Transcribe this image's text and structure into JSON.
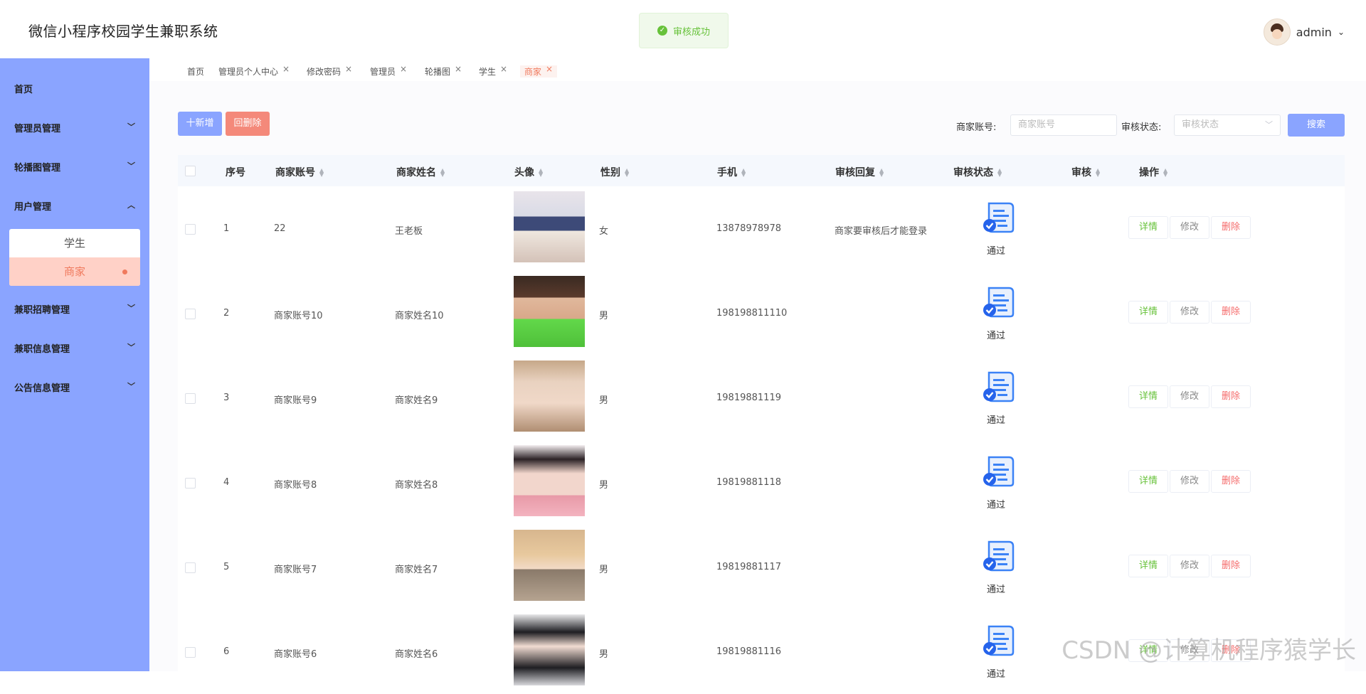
{
  "header": {
    "title": "微信小程序校园学生兼职系统",
    "toast": "审核成功",
    "username": "admin"
  },
  "sidebar": {
    "items": [
      {
        "label": "首页"
      },
      {
        "label": "管理员管理"
      },
      {
        "label": "轮播图管理"
      },
      {
        "label": "用户管理"
      },
      {
        "label": "兼职招聘管理"
      },
      {
        "label": "兼职信息管理"
      },
      {
        "label": "公告信息管理"
      }
    ],
    "submenu": [
      {
        "label": "学生"
      },
      {
        "label": "商家"
      }
    ]
  },
  "tabs": [
    {
      "label": "首页"
    },
    {
      "label": "管理员个人中心"
    },
    {
      "label": "修改密码"
    },
    {
      "label": "管理员"
    },
    {
      "label": "轮播图"
    },
    {
      "label": "学生"
    },
    {
      "label": "商家"
    }
  ],
  "toolbar": {
    "add_label": "十新增",
    "delete_label": "回删除",
    "account_label": "商家账号:",
    "account_placeholder": "商家账号",
    "status_label": "审核状态:",
    "status_placeholder": "审核状态",
    "search_label": "搜索"
  },
  "table": {
    "headers": [
      "序号",
      "商家账号",
      "商家姓名",
      "头像",
      "性别",
      "手机",
      "审核回复",
      "审核状态",
      "审核",
      "操作"
    ],
    "rows": [
      {
        "index": "1",
        "account": "22",
        "name": "王老板",
        "gender": "女",
        "phone": "13878978978",
        "reply": "商家要审核后才能登录",
        "status": "通过"
      },
      {
        "index": "2",
        "account": "商家账号10",
        "name": "商家姓名10",
        "gender": "男",
        "phone": "198198811110",
        "reply": "",
        "status": "通过"
      },
      {
        "index": "3",
        "account": "商家账号9",
        "name": "商家姓名9",
        "gender": "男",
        "phone": "19819881119",
        "reply": "",
        "status": "通过"
      },
      {
        "index": "4",
        "account": "商家账号8",
        "name": "商家姓名8",
        "gender": "男",
        "phone": "19819881118",
        "reply": "",
        "status": "通过"
      },
      {
        "index": "5",
        "account": "商家账号7",
        "name": "商家姓名7",
        "gender": "男",
        "phone": "19819881117",
        "reply": "",
        "status": "通过"
      },
      {
        "index": "6",
        "account": "商家账号6",
        "name": "商家姓名6",
        "gender": "男",
        "phone": "19819881116",
        "reply": "",
        "status": "通过"
      }
    ],
    "actions": {
      "detail": "详情",
      "edit": "修改",
      "delete": "删除"
    }
  },
  "watermark": "CSDN @计算机程序猿学长",
  "colors": {
    "sidebar": "#8aa4ff",
    "accent": "#f07a5e",
    "primary_button": "#8aa4ff",
    "danger_button": "#f4897a",
    "success": "#67c23a"
  },
  "icons": [
    "check-circle-icon",
    "user-avatar-icon",
    "chevron-down-icon",
    "chevron-up-icon",
    "close-icon",
    "sort-icon",
    "audit-document-check-icon"
  ]
}
